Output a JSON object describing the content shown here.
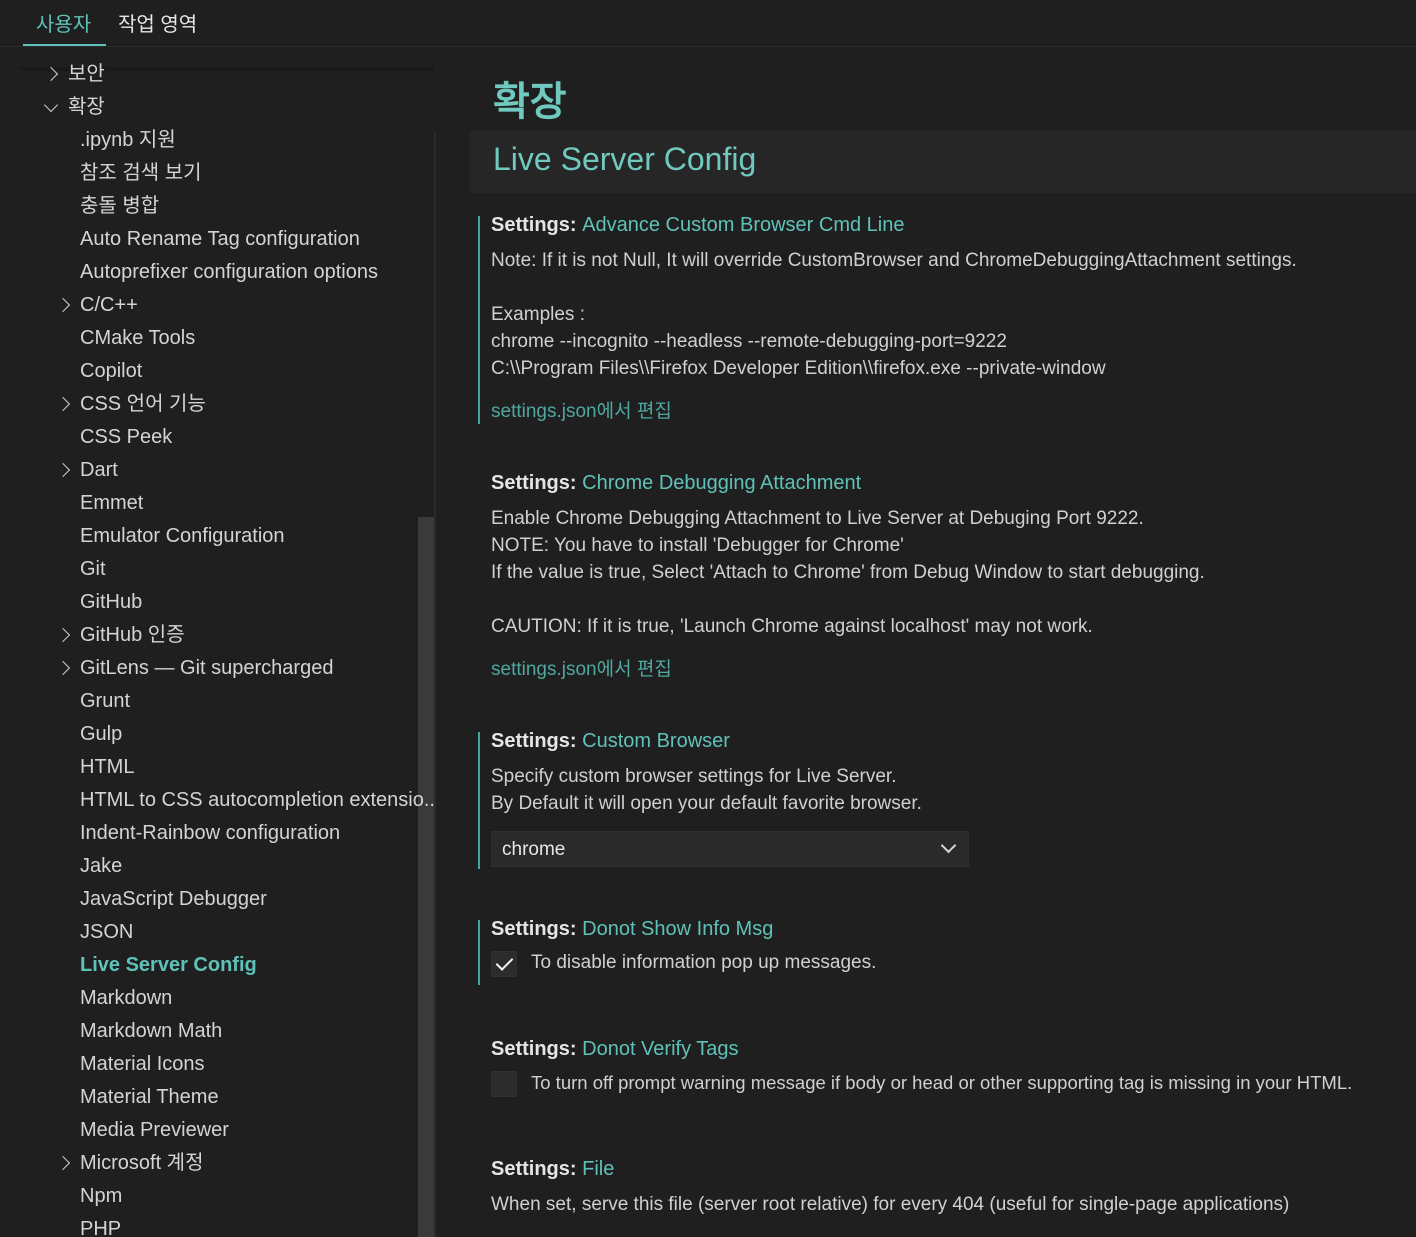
{
  "tabs": {
    "user": "사용자",
    "workspace": "작업 영역"
  },
  "sidebar": {
    "items": [
      {
        "label": "보안",
        "chevron": "right",
        "level": 0
      },
      {
        "label": "확장",
        "chevron": "down",
        "level": 0
      },
      {
        "label": ".ipynb 지원",
        "chevron": "",
        "level": 1
      },
      {
        "label": "참조 검색 보기",
        "chevron": "",
        "level": 1
      },
      {
        "label": "충돌 병합",
        "chevron": "",
        "level": 1
      },
      {
        "label": "Auto Rename Tag configuration",
        "chevron": "",
        "level": 1
      },
      {
        "label": "Autoprefixer configuration options",
        "chevron": "",
        "level": 1
      },
      {
        "label": "C/C++",
        "chevron": "right",
        "level": 1
      },
      {
        "label": "CMake Tools",
        "chevron": "",
        "level": 1
      },
      {
        "label": "Copilot",
        "chevron": "",
        "level": 1
      },
      {
        "label": "CSS 언어 기능",
        "chevron": "right",
        "level": 1
      },
      {
        "label": "CSS Peek",
        "chevron": "",
        "level": 1
      },
      {
        "label": "Dart",
        "chevron": "right",
        "level": 1
      },
      {
        "label": "Emmet",
        "chevron": "",
        "level": 1
      },
      {
        "label": "Emulator Configuration",
        "chevron": "",
        "level": 1
      },
      {
        "label": "Git",
        "chevron": "",
        "level": 1
      },
      {
        "label": "GitHub",
        "chevron": "",
        "level": 1
      },
      {
        "label": "GitHub 인증",
        "chevron": "right",
        "level": 1
      },
      {
        "label": "GitLens — Git supercharged",
        "chevron": "right",
        "level": 1
      },
      {
        "label": "Grunt",
        "chevron": "",
        "level": 1
      },
      {
        "label": "Gulp",
        "chevron": "",
        "level": 1
      },
      {
        "label": "HTML",
        "chevron": "",
        "level": 1
      },
      {
        "label": "HTML to CSS autocompletion extensio...",
        "chevron": "",
        "level": 1
      },
      {
        "label": "Indent-Rainbow configuration",
        "chevron": "",
        "level": 1
      },
      {
        "label": "Jake",
        "chevron": "",
        "level": 1
      },
      {
        "label": "JavaScript Debugger",
        "chevron": "",
        "level": 1
      },
      {
        "label": "JSON",
        "chevron": "",
        "level": 1
      },
      {
        "label": "Live Server Config",
        "chevron": "",
        "level": 1,
        "active": true
      },
      {
        "label": "Markdown",
        "chevron": "",
        "level": 1
      },
      {
        "label": "Markdown Math",
        "chevron": "",
        "level": 1
      },
      {
        "label": "Material Icons",
        "chevron": "",
        "level": 1
      },
      {
        "label": "Material Theme",
        "chevron": "",
        "level": 1
      },
      {
        "label": "Media Previewer",
        "chevron": "",
        "level": 1
      },
      {
        "label": "Microsoft 계정",
        "chevron": "right",
        "level": 1
      },
      {
        "label": "Npm",
        "chevron": "",
        "level": 1
      },
      {
        "label": "PHP",
        "chevron": "",
        "level": 1
      }
    ]
  },
  "main": {
    "page_title": "확장",
    "section_title": "Live Server Config",
    "settings": [
      {
        "category": "Settings: ",
        "name": "Advance Custom Browser Cmd Line",
        "description": "Note: If it is not Null, It will override CustomBrowser and ChromeDebuggingAttachment settings.\n\nExamples :\nchrome --incognito --headless --remote-debugging-port=9222\nC:\\\\Program Files\\\\Firefox Developer Edition\\\\firefox.exe --private-window",
        "link": "settings.json에서 편집"
      },
      {
        "category": "Settings: ",
        "name": "Chrome Debugging Attachment",
        "description": "Enable Chrome Debugging Attachment to Live Server at Debuging Port 9222.\nNOTE: You have to install 'Debugger for Chrome'\nIf the value is true, Select 'Attach to Chrome' from Debug Window to start debugging.\n\nCAUTION: If it is true, 'Launch Chrome against localhost' may not work.",
        "link": "settings.json에서 편집"
      },
      {
        "category": "Settings: ",
        "name": "Custom Browser",
        "description": "Specify custom browser settings for Live Server.\nBy Default it will open your default favorite browser.",
        "select_value": "chrome"
      },
      {
        "category": "Settings: ",
        "name": "Donot Show Info Msg",
        "checkbox_label": "To disable information pop up messages.",
        "checked": true
      },
      {
        "category": "Settings: ",
        "name": "Donot Verify Tags",
        "checkbox_label": "To turn off prompt warning message if body or head or other supporting tag is missing in your HTML.",
        "checked": false
      },
      {
        "category": "Settings: ",
        "name": "File",
        "description": "When set, serve this file (server root relative) for every 404 (useful for single-page applications)"
      }
    ]
  },
  "colors": {
    "accent": "#5fc2b9",
    "background": "#1f1f1f",
    "focus_bar": "#3fa6a1"
  }
}
